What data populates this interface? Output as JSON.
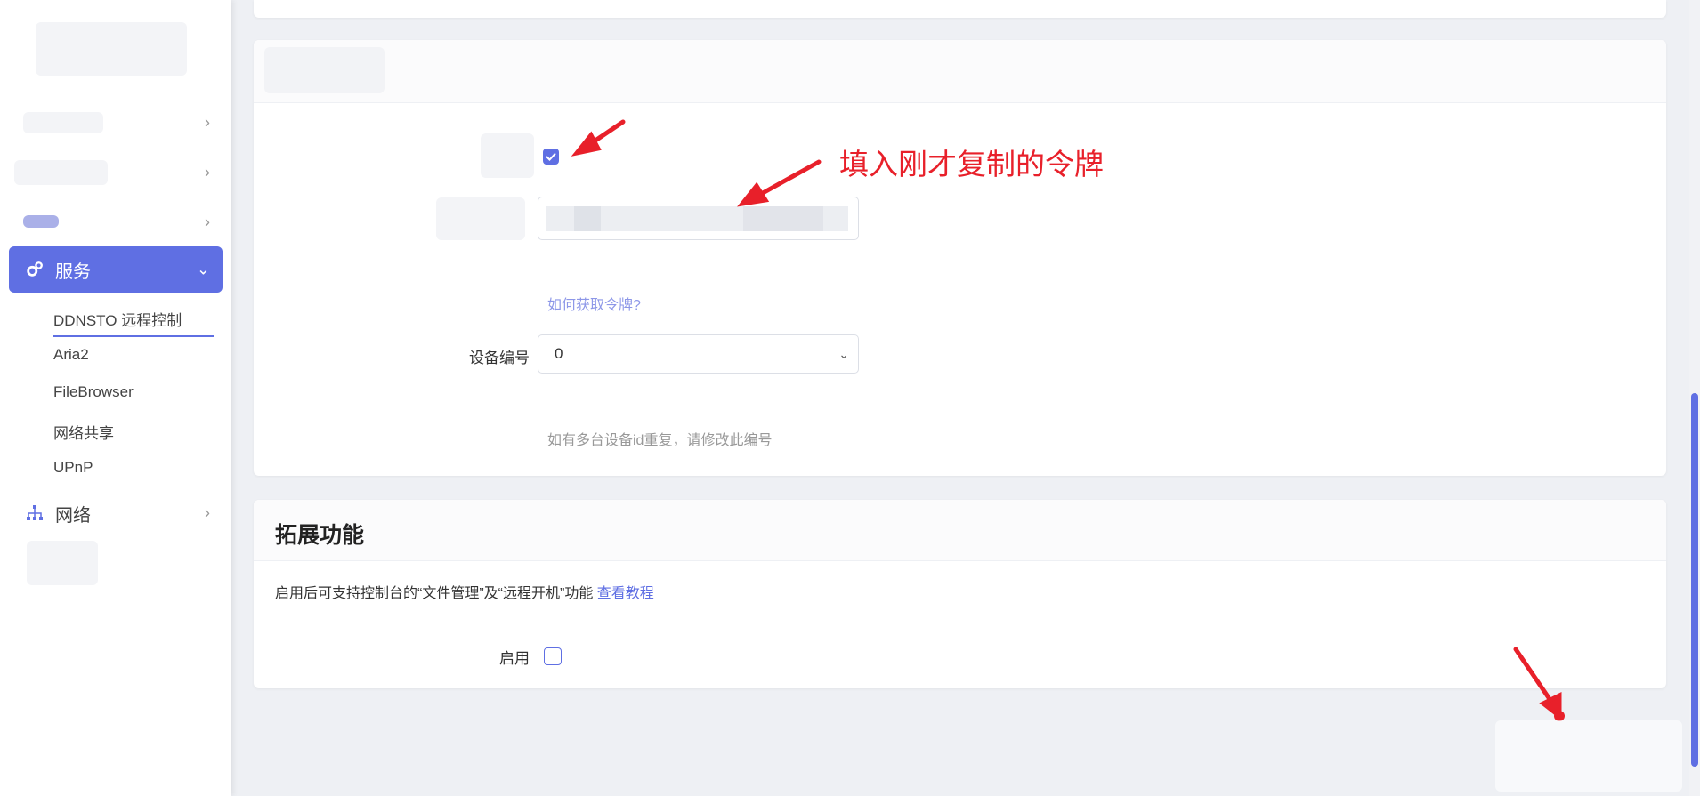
{
  "sidebar": {
    "items": [
      {
        "label": "服务",
        "icon": "gear-icon"
      },
      {
        "label": "网络",
        "icon": "network-icon"
      }
    ],
    "sub_items": [
      "DDNSTO 远程控制",
      "Aria2",
      "FileBrowser",
      "网络共享",
      "UPnP"
    ]
  },
  "config": {
    "token_hint_link": "如何获取令牌?",
    "device_label": "设备编号",
    "device_value": "0",
    "device_hint": "如有多台设备id重复，请修改此编号"
  },
  "extension": {
    "title": "拓展功能",
    "desc_prefix": "启用后可支持控制台的“文件管理”及“远程开机”功能 ",
    "desc_link": "查看教程",
    "enable_label": "启用"
  },
  "annotation": {
    "text": "填入刚才复制的令牌",
    "color": "#e8202a"
  },
  "colors": {
    "accent": "#5f6fe3"
  }
}
